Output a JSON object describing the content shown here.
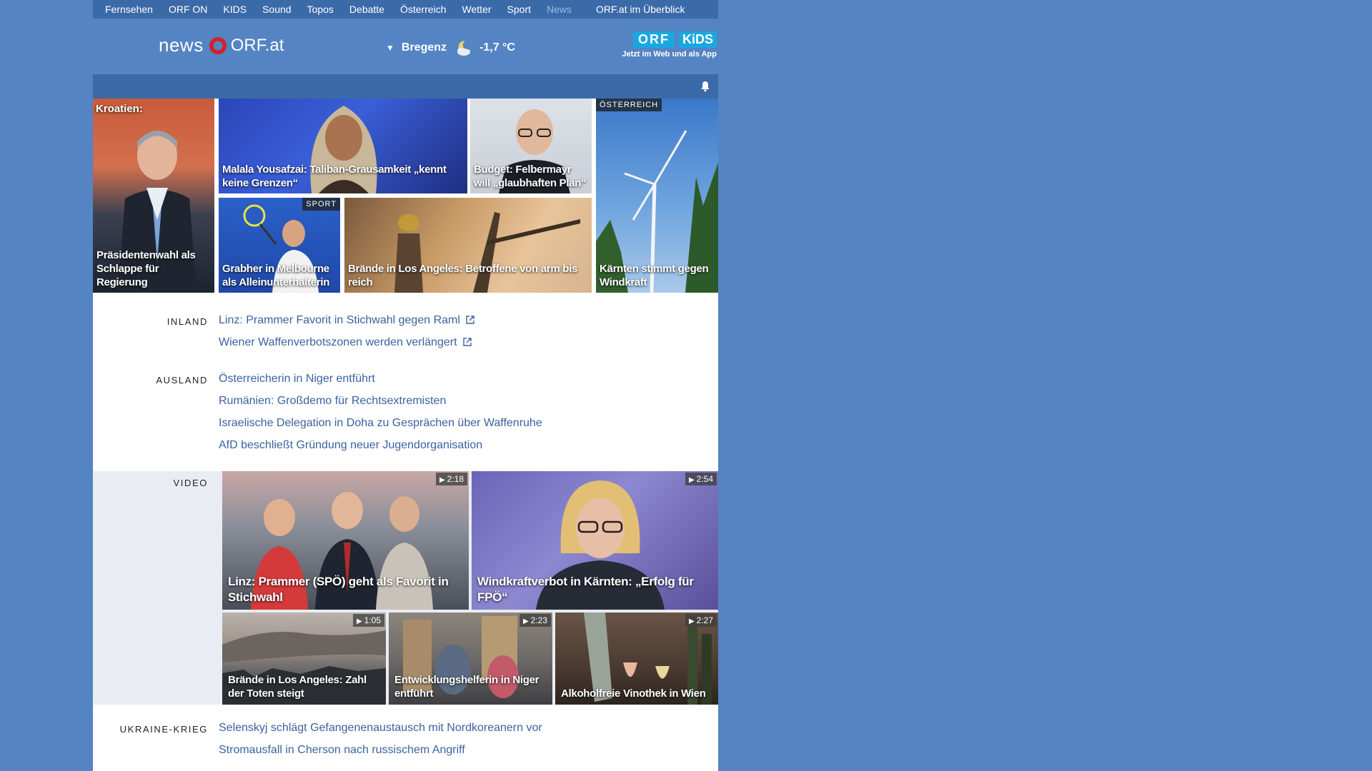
{
  "topnav": {
    "items": [
      "Fernsehen",
      "ORF ON",
      "KIDS",
      "Sound",
      "Topos",
      "Debatte",
      "Österreich",
      "Wetter",
      "Sport",
      "News"
    ],
    "overview": "ORF.at im Überblick"
  },
  "header": {
    "logo_news": "news",
    "logo_orf": "ORF.at",
    "weather_city": "Bregenz",
    "weather_temp": "-1,7 °C",
    "kids_orf": "ORF",
    "kids_kids": "KiDS",
    "kids_tagline": "Jetzt im Web und als App"
  },
  "hero": {
    "croatia_kicker": "Kroatien:",
    "croatia_caption": "Präsidentenwahl als Schlappe für Regierung",
    "malala_caption": "Malala Yousafzai: Taliban-Grausamkeit „kennt keine Grenzen“",
    "budget_caption": "Budget: Felbermayr will „glaubhaften Plan“",
    "austria_label": "ÖSTERREICH",
    "austria_caption": "Kärnten stimmt gegen Windkraft",
    "sport_label": "SPORT",
    "sport_caption": "Grabher in Melbourne als Alleinunterhalterin",
    "la_caption": "Brände in Los Angeles: Betroffene von arm bis reich"
  },
  "inland": {
    "title": "INLAND",
    "links": [
      "Linz: Prammer Favorit in Stichwahl gegen Raml",
      "Wiener Waffenverbotszonen werden verlängert"
    ]
  },
  "ausland": {
    "title": "AUSLAND",
    "links": [
      "Österreicherin in Niger entführt",
      "Rumänien: Großdemo für Rechtsextremisten",
      "Israelische Delegation in Doha zu Gesprächen über Waffenruhe",
      "AfD beschließt Gründung neuer Jugendorganisation"
    ]
  },
  "video": {
    "title": "VIDEO",
    "items": [
      {
        "caption": "Linz: Prammer (SPÖ) geht als Favorit in Stichwahl",
        "duration": "2:18"
      },
      {
        "caption": "Windkraftverbot in Kärnten: „Erfolg für FPÖ“",
        "duration": "2:54"
      },
      {
        "caption": "Brände in Los Angeles: Zahl der Toten steigt",
        "duration": "1:05"
      },
      {
        "caption": "Entwicklungshelferin in Niger entführt",
        "duration": "2:23"
      },
      {
        "caption": "Alkoholfreie Vinothek in Wien",
        "duration": "2:27"
      }
    ]
  },
  "ukraine": {
    "title": "UKRAINE-KRIEG",
    "links": [
      "Selenskyj schlägt Gefangenenaustausch mit Nordkoreanern vor",
      "Stromausfall in Cherson nach russischem Angriff"
    ]
  },
  "colors": {
    "background": "#5484c3",
    "nav_bar": "#3b6aa9",
    "link": "#3a62a0",
    "orf_red": "#d61f26",
    "kids_blue": "#1aa7e0"
  }
}
